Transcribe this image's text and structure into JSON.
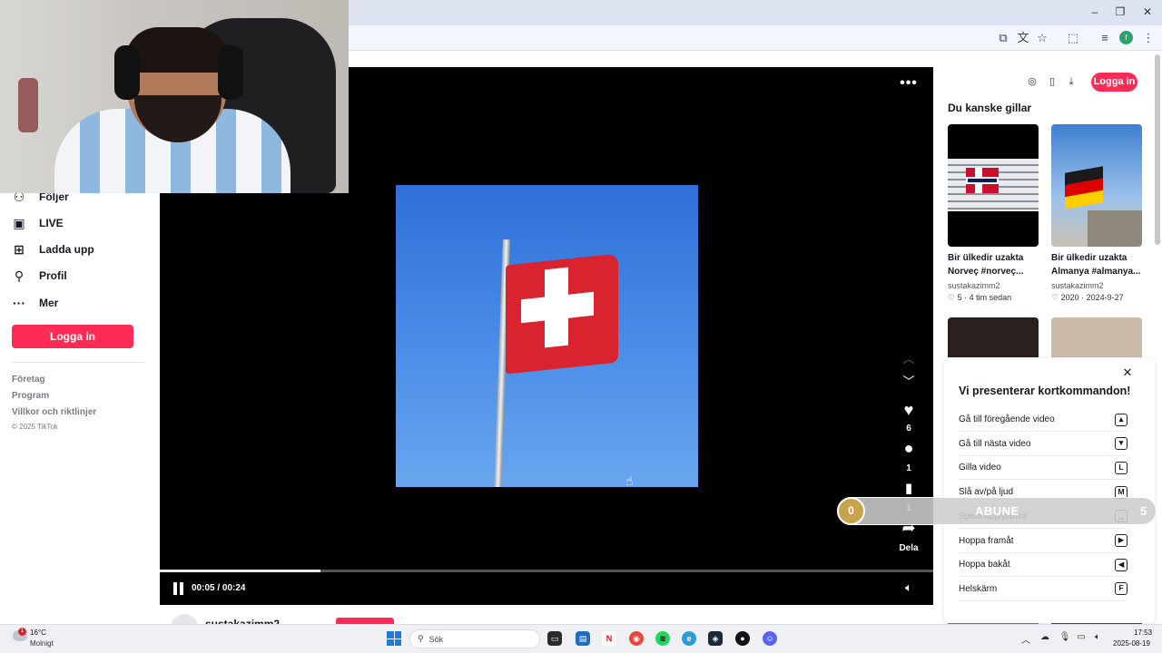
{
  "browser": {
    "window_controls": [
      "–",
      "❐",
      "✕"
    ],
    "profile_initial": "f"
  },
  "sidebar": {
    "items": [
      {
        "label": "Följer",
        "icon": "following-icon"
      },
      {
        "label": "LIVE",
        "icon": "live-icon"
      },
      {
        "label": "Ladda upp",
        "icon": "upload-icon"
      },
      {
        "label": "Profil",
        "icon": "profile-icon"
      },
      {
        "label": "Mer",
        "icon": "more-icon"
      }
    ],
    "login_label": "Logga in",
    "footer_links": [
      "Företag",
      "Program",
      "Villkor och riktlinjer"
    ],
    "copyright": "© 2025 TikTok"
  },
  "video": {
    "likes": "6",
    "comments": "1",
    "saves": "1",
    "share_label": "Dela",
    "time": "00:05 / 00:24",
    "progress": 0.2083
  },
  "header": {
    "login_label": "Logga in"
  },
  "suggestions": {
    "title": "Du kanske gillar",
    "items": [
      {
        "caption_line1": "Bir ülkedir uzakta",
        "caption_line2": "Norveç #norveç...",
        "user": "sustakazimm2",
        "likes": "5",
        "age": "4 tim sedan"
      },
      {
        "caption_line1": "Bir ülkedir uzakta",
        "caption_line2": "Almanya #almanya...",
        "user": "sustakazimm2",
        "likes": "2020",
        "age": "2024-9-27"
      }
    ]
  },
  "shortcuts": {
    "title": "Vi presenterar kortkommandon!",
    "items": [
      {
        "label": "Gå till föregående video",
        "key": "▲"
      },
      {
        "label": "Gå till nästa video",
        "key": "▼"
      },
      {
        "label": "Gilla video",
        "key": "L"
      },
      {
        "label": "Slå av/på ljud",
        "key": "M"
      },
      {
        "label": "Spela upp/pausa",
        "key": "␣"
      },
      {
        "label": "Hoppa framåt",
        "key": "▶"
      },
      {
        "label": "Hoppa bakåt",
        "key": "◀"
      },
      {
        "label": "Helskärm",
        "key": "F"
      }
    ]
  },
  "overlay": {
    "current": "0",
    "label": "ABUNE",
    "target": "5"
  },
  "author": {
    "username": "sustakazimm2"
  },
  "taskbar": {
    "weather_temp": "16°C",
    "weather_desc": "Molnigt",
    "weather_badge": "1",
    "search_placeholder": "Sök",
    "time": "17:53",
    "date": "2025-08-19"
  }
}
